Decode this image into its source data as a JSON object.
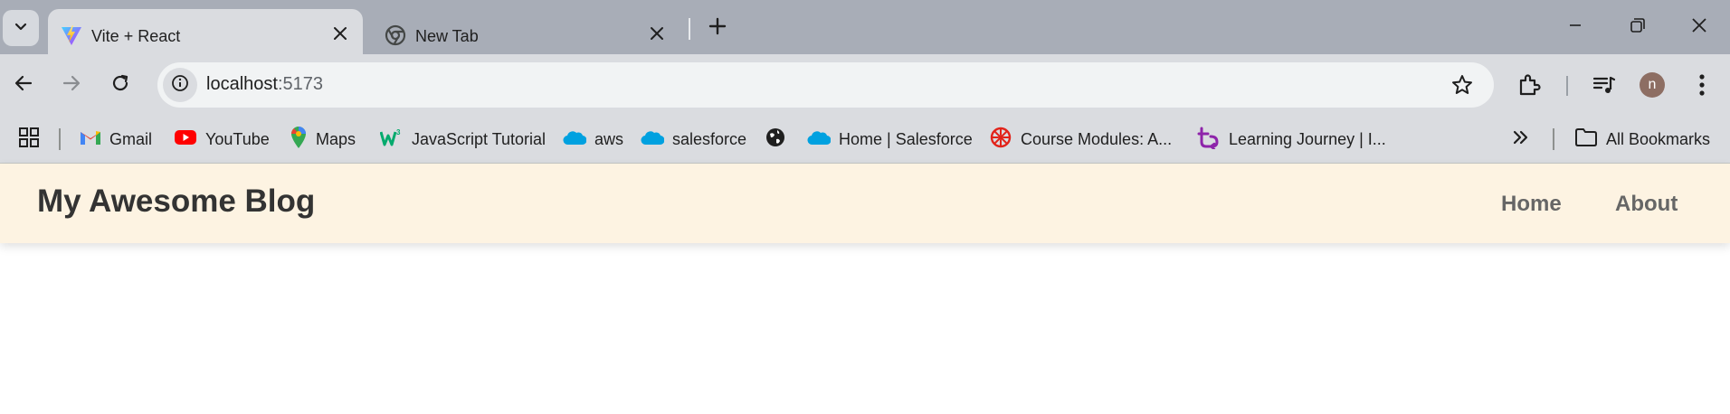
{
  "browser": {
    "tabs": [
      {
        "title": "Vite + React",
        "icon": "vite-icon",
        "active": true
      },
      {
        "title": "New Tab",
        "icon": "chrome-icon",
        "active": false
      }
    ],
    "address": {
      "host": "localhost",
      "port": ":5173"
    },
    "profile_initial": "n",
    "bookmarks": [
      {
        "label": "Gmail",
        "icon": "gmail-icon"
      },
      {
        "label": "YouTube",
        "icon": "youtube-icon"
      },
      {
        "label": "Maps",
        "icon": "maps-icon"
      },
      {
        "label": "JavaScript Tutorial",
        "icon": "w3schools-icon"
      },
      {
        "label": "aws",
        "icon": "salesforce-cloud-icon"
      },
      {
        "label": "salesforce",
        "icon": "salesforce-cloud-icon"
      },
      {
        "label": "",
        "icon": "globe-icon"
      },
      {
        "label": "Home | Salesforce",
        "icon": "salesforce-cloud-icon"
      },
      {
        "label": "Course Modules: A...",
        "icon": "course-icon"
      },
      {
        "label": "Learning Journey | I...",
        "icon": "learning-icon"
      }
    ],
    "all_bookmarks_label": "All Bookmarks"
  },
  "page": {
    "brand": "My Awesome Blog",
    "nav": [
      {
        "label": "Home"
      },
      {
        "label": "About"
      }
    ]
  },
  "colors": {
    "header_bg": "#fdf3e2",
    "brand_text": "#333333",
    "nav_text": "#666666"
  }
}
